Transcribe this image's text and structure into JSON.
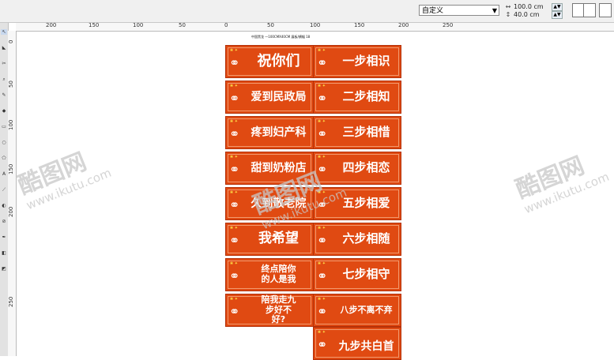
{
  "toolbar": {
    "page_preset": "自定义",
    "width_value": "100.0 cm",
    "height_value": "40.0 cm"
  },
  "ruler": {
    "horizontal_labels": [
      "200",
      "150",
      "100",
      "50",
      "0",
      "50",
      "100",
      "150",
      "200",
      "250"
    ],
    "vertical_labels": [
      "0",
      "50",
      "100",
      "150",
      "200",
      "250"
    ]
  },
  "document": {
    "title": "中国黑龙 一100CMX40CM 展板/横幅 18"
  },
  "signs": {
    "left": [
      {
        "text": "祝你们"
      },
      {
        "text": "爱到民政局"
      },
      {
        "text": "疼到妇产科"
      },
      {
        "text": "甜到奶粉店"
      },
      {
        "text": "久到敬老院"
      },
      {
        "text": "我希望"
      },
      {
        "text": "终点陪你的人是我"
      },
      {
        "text": "陪我走九步好不好?"
      }
    ],
    "right": [
      {
        "text": "一步相识"
      },
      {
        "text": "二步相知"
      },
      {
        "text": "三步相惜"
      },
      {
        "text": "四步相恋"
      },
      {
        "text": "五步相爱"
      },
      {
        "text": "六步相随"
      },
      {
        "text": "七步相守"
      },
      {
        "text": "八步不离不弃"
      },
      {
        "text": "九步共白首"
      }
    ]
  },
  "watermark": {
    "brand": "酷图网",
    "url": "www.ikutu.com"
  },
  "colors": {
    "sign_fill": "#e04a12",
    "sign_text": "#ffffff"
  }
}
